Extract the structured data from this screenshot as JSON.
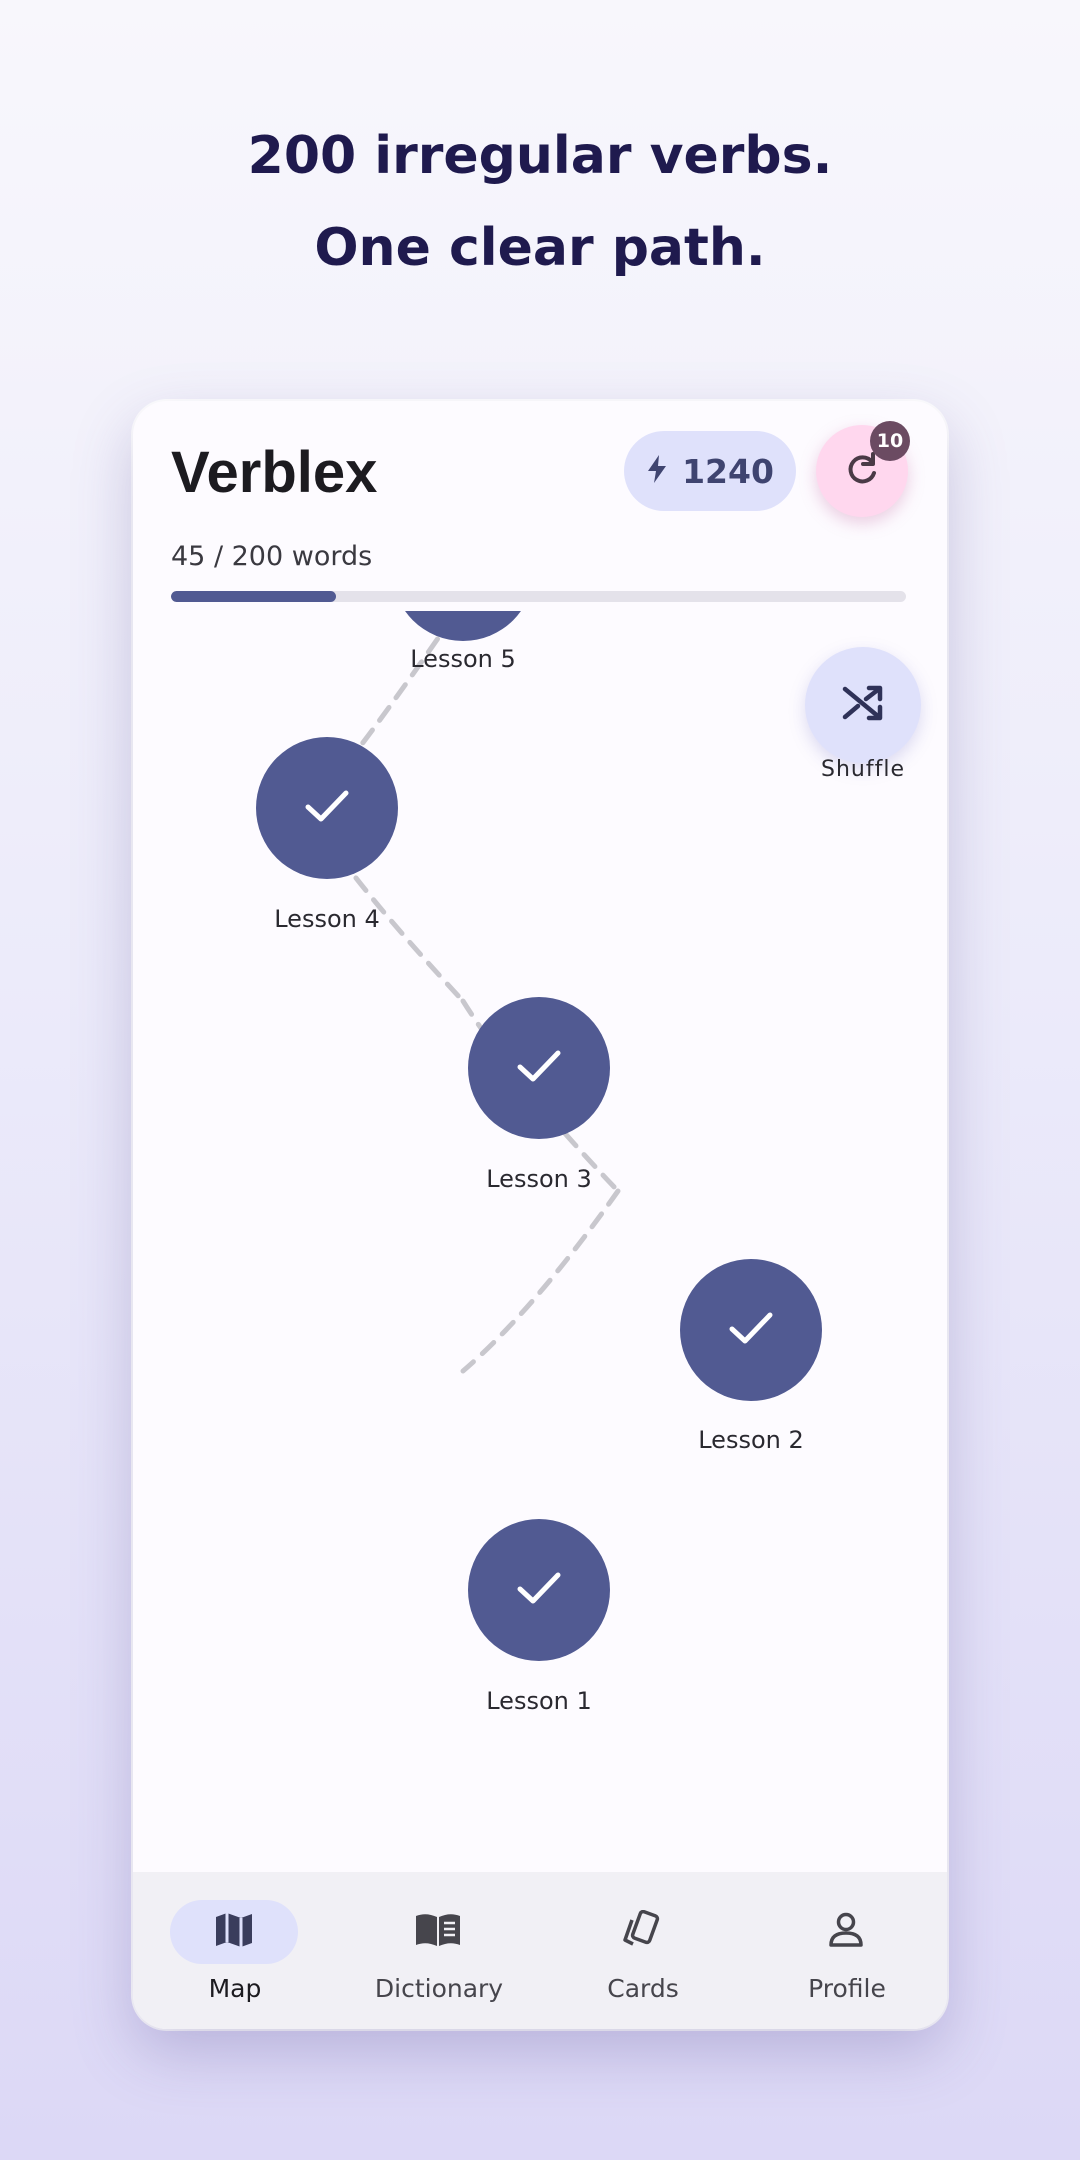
{
  "headline": {
    "line1": "200 irregular verbs.",
    "line2": "One clear path."
  },
  "app": {
    "title": "Verblex",
    "xp": "1240",
    "review_badge": "10",
    "progress_label": "45 / 200 words",
    "progress_fraction": 0.225
  },
  "map": {
    "shuffle_label": "Shuffle",
    "lessons": [
      {
        "label": "Lesson 5",
        "completed": true
      },
      {
        "label": "Lesson 4",
        "completed": true
      },
      {
        "label": "Lesson 3",
        "completed": true
      },
      {
        "label": "Lesson 2",
        "completed": true
      },
      {
        "label": "Lesson 1",
        "completed": true
      }
    ]
  },
  "nav": {
    "items": [
      {
        "label": "Map",
        "icon": "map-icon",
        "active": true
      },
      {
        "label": "Dictionary",
        "icon": "book-icon",
        "active": false
      },
      {
        "label": "Cards",
        "icon": "cards-icon",
        "active": false
      },
      {
        "label": "Profile",
        "icon": "person-icon",
        "active": false
      }
    ]
  },
  "colors": {
    "node": "#515a92",
    "accent_chip": "#dfe1fb",
    "review": "#ffd7ee",
    "headline": "#1f1a4e"
  }
}
